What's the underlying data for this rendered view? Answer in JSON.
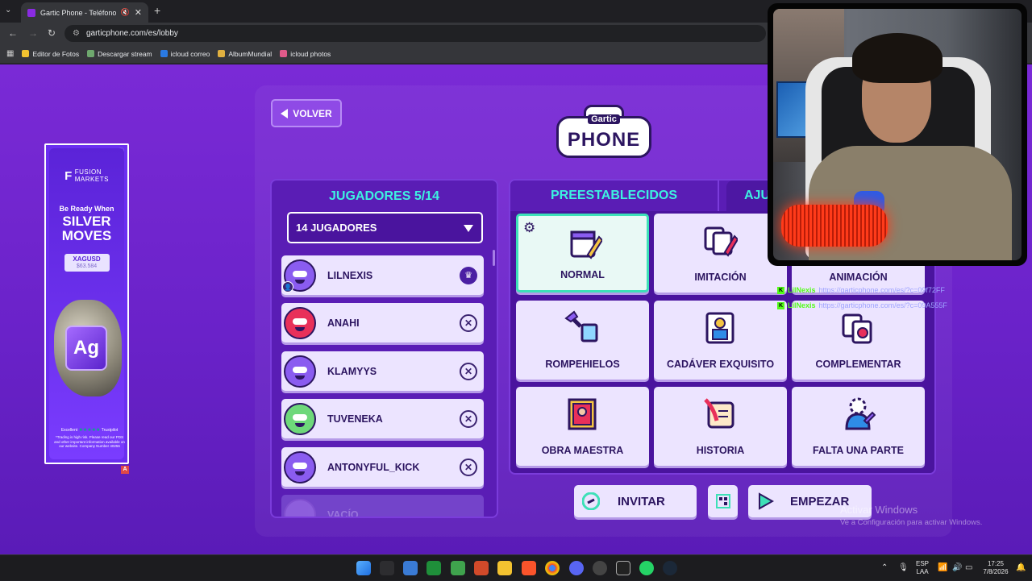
{
  "browser": {
    "tab_title": "Gartic Phone - Teléfono De...",
    "url": "garticphone.com/es/lobby",
    "bookmarks": [
      {
        "label": "Editor de Fotos",
        "color": "#f2c230"
      },
      {
        "label": "Descargar stream",
        "color": "#6ea86e"
      },
      {
        "label": "icloud correo",
        "color": "#2a7ae4"
      },
      {
        "label": "AlbumMundial",
        "color": "#e0b040"
      },
      {
        "label": "icloud photos",
        "color": "#e05a8a"
      }
    ]
  },
  "ad": {
    "brand_line1": "FUSION",
    "brand_line2": "MARKETS",
    "tagline": "Be Ready When",
    "headline1": "SILVER",
    "headline2": "MOVES",
    "ticker": "XAGUSD",
    "price": "$63.584",
    "element": "Ag",
    "rating": "Excellent",
    "rating_source": "Trustpilot",
    "fine_print": "*Trading is high risk. Please read our PDS and other important information available on our website. Company Number 40256"
  },
  "lobby": {
    "back_label": "VOLVER",
    "logo_top": "Gartic",
    "logo_main": "PHONE",
    "players_title": "JUGADORES 5/14",
    "player_limit": "14 JUGADORES",
    "players": [
      {
        "name": "LILNEXIS",
        "host": true,
        "color": "#8a5cf0"
      },
      {
        "name": "ANAHI",
        "host": false,
        "color": "#e8305a"
      },
      {
        "name": "KLAMYYS",
        "host": false,
        "color": "#8a5cf0"
      },
      {
        "name": "TUVENEKA",
        "host": false,
        "color": "#6ed87a"
      },
      {
        "name": "ANTONYFUL_KICK",
        "host": false,
        "color": "#8a5cf0"
      }
    ],
    "empty_slot": "VACÍO",
    "tab_presets": "PREESTABLECIDOS",
    "tab_settings": "AJU",
    "modes": [
      {
        "label": "NORMAL",
        "selected": true
      },
      {
        "label": "IMITACIÓN",
        "selected": false
      },
      {
        "label": "ANIMACIÓN",
        "selected": false
      },
      {
        "label": "ROMPEHIELOS",
        "selected": false
      },
      {
        "label": "CADÁVER EXQUISITO",
        "selected": false
      },
      {
        "label": "COMPLEMENTAR",
        "selected": false
      },
      {
        "label": "OBRA MAESTRA",
        "selected": false
      },
      {
        "label": "HISTORIA",
        "selected": false
      },
      {
        "label": "FALTA UNA PARTE",
        "selected": false
      }
    ],
    "invite_label": "INVITAR",
    "start_label": "EMPEZAR"
  },
  "chat": [
    {
      "user": "LilNexis",
      "text": "https://garticphone.com/es/?c=09f72FF"
    },
    {
      "user": "LilNexis",
      "text": "https://garticphone.com/es/?c=09A555F"
    }
  ],
  "windows": {
    "activate_title": "Activar Windows",
    "activate_sub": "Ve a Configuración para activar Windows.",
    "lang1": "ESP",
    "lang2": "LAA",
    "time": "17:25",
    "date": "7/8/2026"
  }
}
